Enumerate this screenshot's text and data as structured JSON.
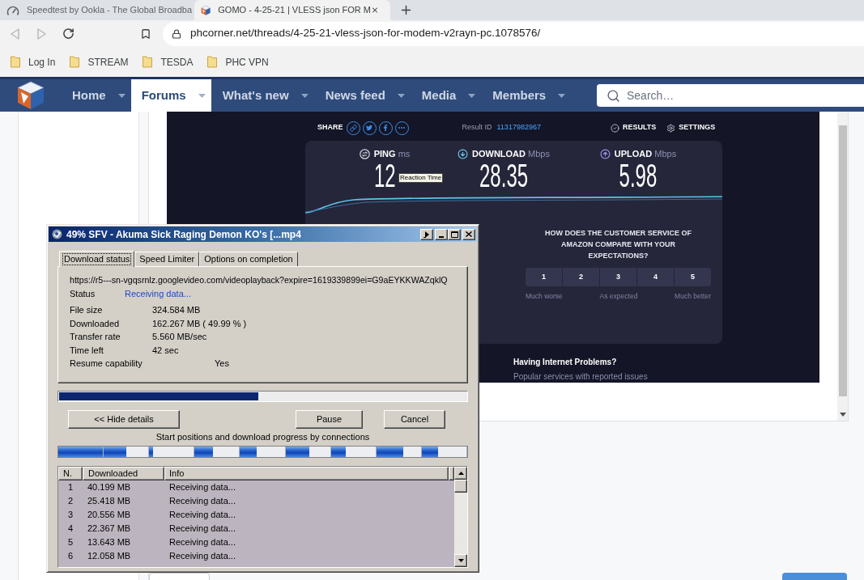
{
  "browser": {
    "tabs": [
      {
        "title": "Speedtest by Ookla - The Global Broadba",
        "selected": false
      },
      {
        "title": "GOMO - 4-25-21 | VLESS json FOR M",
        "selected": true
      }
    ],
    "address": "phcorner.net/threads/4-25-21-vless-json-for-modem-v2rayn-pc.1078576/",
    "bookmarks": [
      "Log In",
      "STREAM",
      "TESDA",
      "PHC VPN"
    ]
  },
  "forum_nav": {
    "items": [
      {
        "label": "Home",
        "selected": false
      },
      {
        "label": "Forums",
        "selected": true
      },
      {
        "label": "What's new",
        "selected": false
      },
      {
        "label": "News feed",
        "selected": false
      },
      {
        "label": "Media",
        "selected": false
      },
      {
        "label": "Members",
        "selected": false
      }
    ],
    "search": {
      "placeholder": "Search…"
    }
  },
  "speedtest": {
    "share_label": "SHARE",
    "result_id_label": "Result ID",
    "result_id": "11317982967",
    "results_label": "RESULTS",
    "settings_label": "SETTINGS",
    "metrics": [
      {
        "kind": "ping",
        "label": "PING",
        "unit": "ms",
        "value": "12"
      },
      {
        "kind": "download",
        "label": "DOWNLOAD",
        "unit": "Mbps",
        "value": "28.35"
      },
      {
        "kind": "upload",
        "label": "UPLOAD",
        "unit": "Mbps",
        "value": "5.98"
      }
    ],
    "tooltip": "Reaction Time",
    "survey": {
      "question": "HOW DOES THE CUSTOMER SERVICE OF AMAZON COMPARE WITH YOUR EXPECTATIONS?",
      "options": [
        "1",
        "2",
        "3",
        "4",
        "5"
      ],
      "scale_labels": [
        "Much worse",
        "As expected",
        "Much better"
      ]
    },
    "help": {
      "title": "Having Internet Problems?",
      "subtitle": "Popular services with reported issues"
    }
  },
  "download_dialog": {
    "title": "49% SFV - Akuma Sick Raging Demon KO's [...mp4",
    "tabs": [
      {
        "label": "Download status",
        "selected": true
      },
      {
        "label": "Speed Limiter",
        "selected": false
      },
      {
        "label": "Options on completion",
        "selected": false
      }
    ],
    "url": "https://r5---sn-vgqsrnlz.googlevideo.com/videoplayback?expire=1619339899ei=G9aEYKKWAZqklQ",
    "status": {
      "label": "Status",
      "value": "Receiving data..."
    },
    "details": [
      {
        "label": "File size",
        "value": "324.584 MB"
      },
      {
        "label": "Downloaded",
        "value": "162.267 MB ( 49.99 % )"
      },
      {
        "label": "Transfer rate",
        "value": "5.560 MB/sec"
      },
      {
        "label": "Time left",
        "value": "42 sec"
      }
    ],
    "resume": {
      "label": "Resume capability",
      "value": "Yes"
    },
    "progress": {
      "level": 0.49
    },
    "buttons": [
      "<< Hide details",
      "Pause",
      "Cancel"
    ],
    "connections_caption": "Start positions and download progress by connections",
    "connection_segments": [
      {
        "level": 1
      },
      {
        "level": 0.51
      },
      {
        "level": 0.09
      },
      {
        "level": 0.42
      },
      {
        "level": 0.37
      },
      {
        "level": 0.53
      },
      {
        "level": 0.33
      },
      {
        "level": 0.6
      },
      {
        "level": 0.37
      }
    ],
    "table": {
      "columns": [
        "N.",
        "Downloaded",
        "Info"
      ],
      "rows": [
        [
          "1",
          "40.199 MB",
          "Receiving data..."
        ],
        [
          "2",
          "25.418 MB",
          "Receiving data..."
        ],
        [
          "3",
          "20.556 MB",
          "Receiving data..."
        ],
        [
          "4",
          "22.367 MB",
          "Receiving data..."
        ],
        [
          "5",
          "13.643 MB",
          "Receiving data..."
        ],
        [
          "6",
          "12.058 MB",
          "Receiving data..."
        ]
      ]
    }
  }
}
